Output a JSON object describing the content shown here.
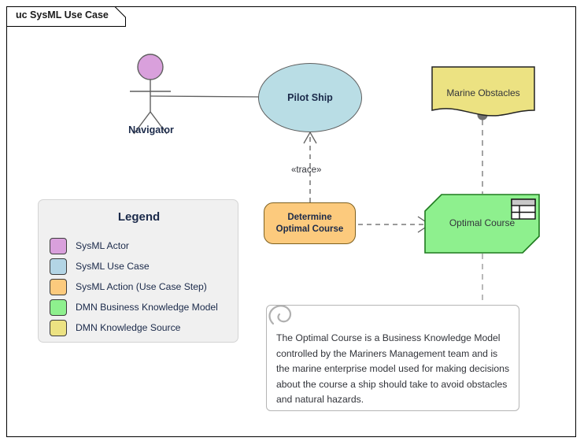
{
  "frame": {
    "title": "uc SysML Use Case"
  },
  "actor": {
    "name": "Navigator",
    "icon": "stick-figure-actor-icon",
    "head_color": "#d9a0dc"
  },
  "use_case": {
    "name": "Pilot Ship",
    "fill": "#b9dde5"
  },
  "action": {
    "name": "Determine\nOptimal Course",
    "fill": "#fcca7d"
  },
  "trace": {
    "stereotype": "«trace»"
  },
  "bkm": {
    "name": "Optimal Course",
    "fill": "#8ef08e",
    "icon": "decision-table-icon"
  },
  "knowledge_source": {
    "name": "Marine Obstacles",
    "fill": "#ece282"
  },
  "note": {
    "text": "The Optimal Course is a Business Knowledge Model controlled by the Mariners Management team and is the marine enterprise model used for making decisions about the course a ship should take to avoid obstacles and natural hazards.",
    "icon": "paperclip-icon"
  },
  "legend": {
    "title": "Legend",
    "items": [
      {
        "label": "SysML Actor",
        "color": "#d9a0dc"
      },
      {
        "label": "SysML Use Case",
        "color": "#b3d5e5"
      },
      {
        "label": "SysML Action (Use Case Step)",
        "color": "#fcca7d"
      },
      {
        "label": "DMN Business Knowledge Model",
        "color": "#8ef08e"
      },
      {
        "label": "DMN Knowledge Source",
        "color": "#ece282"
      }
    ]
  }
}
